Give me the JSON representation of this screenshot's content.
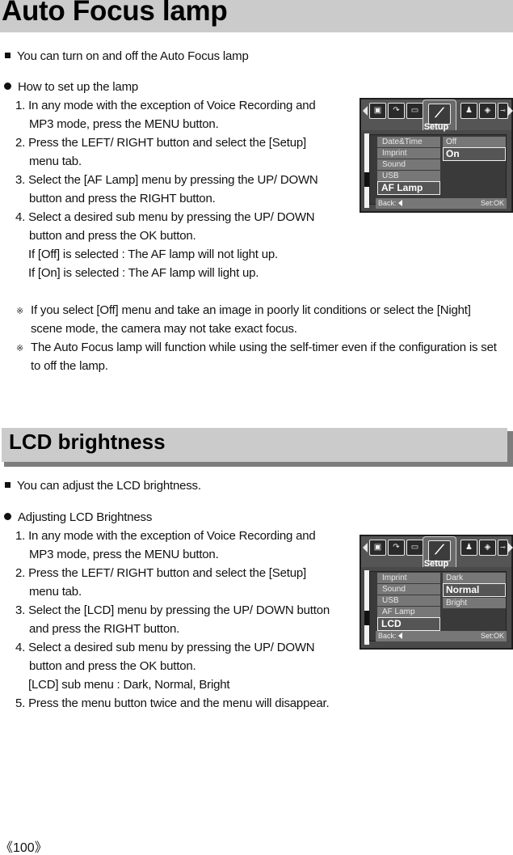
{
  "section1": {
    "title": "Auto Focus lamp",
    "intro": "You can turn on and off the Auto Focus lamp",
    "howto_heading": "How to set up the lamp",
    "lines": [
      "1. In any mode with the exception of Voice Recording and",
      "MP3 mode, press the MENU button.",
      "2. Press the LEFT/ RIGHT button and select the [Setup]",
      "menu tab.",
      "3. Select the [AF Lamp] menu by pressing the UP/ DOWN",
      "button and press the RIGHT button.",
      "4. Select a desired sub menu by pressing the UP/ DOWN",
      "button and press the OK button.",
      "If [Off] is selected : The AF lamp will not light up.",
      "If [On] is selected : The AF lamp will light up."
    ],
    "note_mark": "※",
    "notes": [
      [
        "If you select [Off] menu and take an image in poorly lit conditions or select the [Night]",
        "scene mode, the camera may not take exact focus."
      ],
      [
        "The Auto Focus lamp will function while using the self-timer even if the configuration is set",
        "to off the lamp."
      ]
    ],
    "screen": {
      "tab_label": "Setup",
      "tab_icons": [
        "voice-memo-icon",
        "sound-icon",
        "battery-icon",
        "setup-wrench-icon",
        "user-icon",
        "rotate-icon",
        "key-icon"
      ],
      "menu_items": [
        "Date&Time",
        "Imprint",
        "Sound",
        "USB",
        "AF Lamp"
      ],
      "selected_item": "AF Lamp",
      "options": [
        "Off",
        "On"
      ],
      "selected_option": "On",
      "back_label": "Back:",
      "set_label": "Set:OK"
    }
  },
  "section2": {
    "title": "LCD brightness",
    "intro": "You can adjust the LCD brightness.",
    "howto_heading": "Adjusting LCD Brightness",
    "lines": [
      "1. In any mode with the exception of Voice Recording and",
      "MP3 mode, press the MENU button.",
      "2. Press the LEFT/ RIGHT button and select the [Setup]",
      "menu tab.",
      "3. Select the [LCD] menu by pressing the UP/ DOWN button",
      "and press the RIGHT button.",
      "4. Select a desired sub menu by pressing the UP/ DOWN",
      "button and press the OK button.",
      "[LCD] sub menu : Dark, Normal, Bright",
      "5. Press the menu button twice and the menu will disappear."
    ],
    "screen": {
      "tab_label": "Setup",
      "tab_icons": [
        "voice-memo-icon",
        "sound-icon",
        "battery-icon",
        "setup-wrench-icon",
        "user-icon",
        "rotate-icon",
        "key-icon"
      ],
      "menu_items": [
        "Imprint",
        "Sound",
        "USB",
        "AF Lamp",
        "LCD"
      ],
      "selected_item": "LCD",
      "options": [
        "Dark",
        "Normal",
        "Bright"
      ],
      "selected_option": "Normal",
      "back_label": "Back:",
      "set_label": "Set:OK"
    }
  },
  "page_number": "《100》"
}
